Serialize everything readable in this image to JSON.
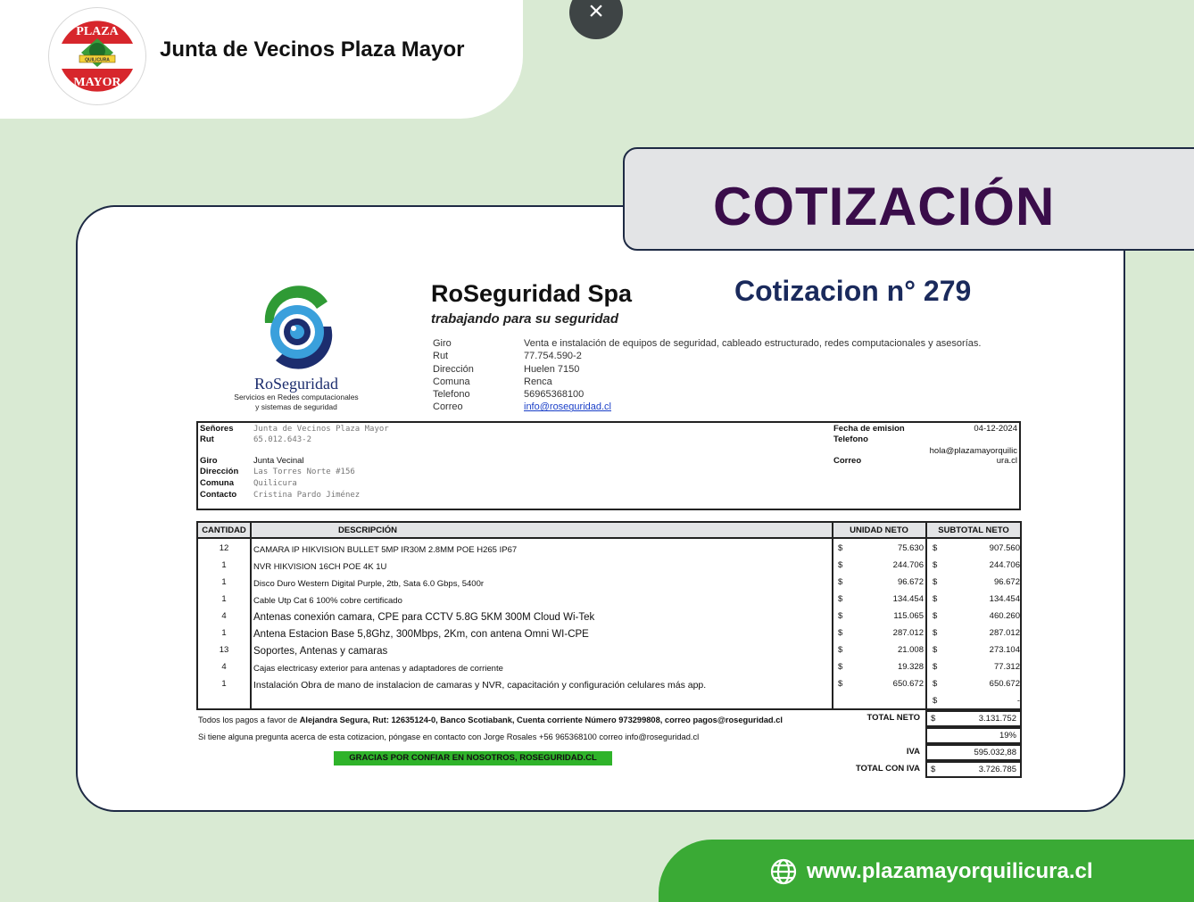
{
  "header": {
    "org_name": "Junta de Vecinos Plaza Mayor",
    "logo": {
      "top_text": "PLAZA",
      "ribbon_text": "QUILICURA",
      "bottom_text": "MAYOR"
    },
    "close_label": "×"
  },
  "title": "COTIZACIÓN",
  "footer": {
    "url": "www.plazamayorquilicura.cl"
  },
  "colors": {
    "green": "#3aaa35",
    "title_purple": "#3a0d4a",
    "navy": "#1a2a5c"
  },
  "quote": {
    "brand_name": "RoSeguridad",
    "brand_sub_1": "Servicios en Redes computacionales",
    "brand_sub_2": "y sistemas de seguridad",
    "company_name": "RoSeguridad Spa",
    "slogan": "trabajando para su seguridad",
    "number_label": "Cotizacion n° 279",
    "company_info": [
      {
        "key": "Giro",
        "value": "Venta e instalación de equipos de seguridad, cableado estructurado, redes computacionales y asesorías."
      },
      {
        "key": "Rut",
        "value": "77.754.590-2"
      },
      {
        "key": "Dirección",
        "value": "Huelen 7150"
      },
      {
        "key": "Comuna",
        "value": "Renca"
      },
      {
        "key": "Telefono",
        "value": "56965368100"
      },
      {
        "key": "Correo",
        "value": "info@roseguridad.cl"
      }
    ],
    "client": {
      "senores_label": "Señores",
      "senores": "Junta de Vecinos Plaza Mayor",
      "rut_label": "Rut",
      "rut": "65.012.643-2",
      "giro_label": "Giro",
      "giro": "Junta Vecinal",
      "direccion_label": "Dirección",
      "direccion": "Las Torres Norte #156",
      "comuna_label": "Comuna",
      "comuna": "Quilicura",
      "contacto_label": "Contacto",
      "contacto": "Cristina Pardo Jiménez",
      "fecha_label": "Fecha de emision",
      "fecha": "04-12-2024",
      "telefono_label": "Telefono",
      "correo_label": "Correo",
      "correo_line1": "hola@plazamayorquilic",
      "correo_line2": "ura.cl"
    },
    "table_headers": {
      "qty": "CANTIDAD",
      "desc": "DESCRIPCIÓN",
      "unit": "UNIDAD NETO",
      "sub": "SUBTOTAL NETO"
    },
    "currency": "$",
    "items": [
      {
        "qty": "12",
        "desc": "CAMARA IP HIKVISION BULLET 5MP IR30M 2.8MM POE H265 IP67",
        "unit": "75.630",
        "sub": "907.560"
      },
      {
        "qty": "1",
        "desc": "NVR HIKVISION 16CH POE 4K 1U",
        "unit": "244.706",
        "sub": "244.706"
      },
      {
        "qty": "1",
        "desc": "Disco Duro Western Digital Purple, 2tb, Sata 6.0 Gbps, 5400r",
        "unit": "96.672",
        "sub": "96.672"
      },
      {
        "qty": "1",
        "desc": "Cable Utp Cat 6 100% cobre certificado",
        "unit": "134.454",
        "sub": "134.454"
      },
      {
        "qty": "4",
        "desc": "Antenas conexión camara, CPE para CCTV 5.8G 5KM 300M Cloud Wi-Tek",
        "unit": "115.065",
        "sub": "460.260"
      },
      {
        "qty": "1",
        "desc": "Antena Estacion Base 5,8Ghz, 300Mbps, 2Km, con antena Omni WI-CPE",
        "unit": "287.012",
        "sub": "287.012"
      },
      {
        "qty": "13",
        "desc": "Soportes, Antenas y camaras",
        "unit": "21.008",
        "sub": "273.104"
      },
      {
        "qty": "4",
        "desc": "Cajas electricasy exterior para antenas y adaptadores de corriente",
        "unit": "19.328",
        "sub": "77.312"
      },
      {
        "qty": "1",
        "desc": "Instalación Obra de mano de instalacion de camaras  y NVR, capacitación y  configuración celulares más app.",
        "unit": "650.672",
        "sub": "650.672"
      }
    ],
    "empty_row_sub": "-",
    "totals": {
      "neto_label": "TOTAL NETO",
      "neto": "3.131.752",
      "iva_pct": "19%",
      "iva_label": "IVA",
      "iva": "595.032,88",
      "total_label": "TOTAL CON IVA",
      "total": "3.726.785"
    },
    "payment_note_prefix": "Todos los pagos a favor de ",
    "payment_note_bold": "Alejandra Segura, Rut: 12635124-0, Banco Scotiabank, Cuenta corriente Número 973299808, correo pagos@roseguridad.cl",
    "contact_note": "Si tiene alguna pregunta acerca de esta cotizacion, póngase en contacto con Jorge Rosales +56 965368100  correo info@roseguridad.cl",
    "thanks": "GRACIAS POR CONFIAR EN NOSOTROS, ROSEGURIDAD.CL"
  }
}
